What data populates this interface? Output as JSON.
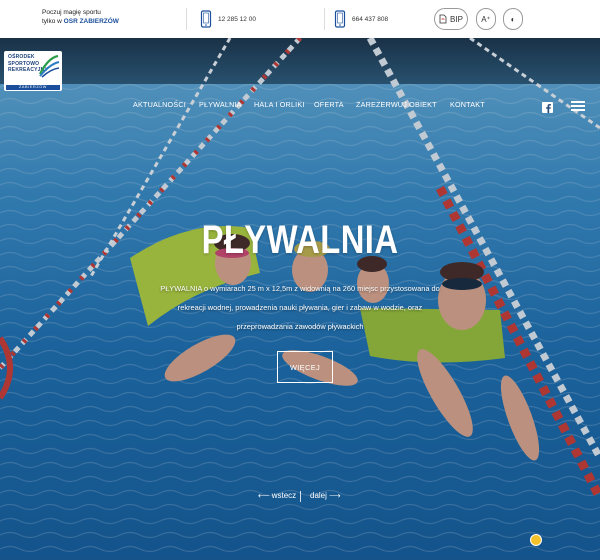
{
  "topbar": {
    "tagline_line1": "Poczuj magię sportu",
    "tagline_line2_prefix": "tylko w ",
    "tagline_brand": "OSR ZABIERZÓW",
    "phone1": "12 285 12 00",
    "phone2": "664 437 808",
    "bip_label": "BIP",
    "fontsize_label": "A⁺",
    "contrast_label": "◐"
  },
  "logo": {
    "line1": "OŚRODEK",
    "line2": "SPORTOWO",
    "line3": "REKREACYJNY",
    "bottom": "ZABIERZÓW"
  },
  "nav": {
    "items": [
      "AKTUALNOŚCI",
      "PŁYWALNIA",
      "HALA I ORLIKI",
      "OFERTA",
      "ZAREZERWUJ OBIEKT",
      "KONTAKT"
    ]
  },
  "hero": {
    "title": "PŁYWALNIA",
    "desc_line1": "PŁYWALNIA o wymiarach 25 m x 12,5m z widownią na 260 miejsc przystosowana do",
    "desc_line2": "rekreacji wodnej, prowadzenia nauki pływania, gier i zabaw w wodzie, oraz",
    "desc_line3": "przeprowadzania zawodów pływackich",
    "more_label": "WIĘCEJ"
  },
  "pager": {
    "prev_label": "⟵ wstecz",
    "next_label": "dalej ⟶"
  },
  "colors": {
    "brand_blue": "#1b4f9c",
    "water": "#1f6fae",
    "lane_red": "#c8322c",
    "float_green": "#b7d43a",
    "badge_yellow": "#f4c12b"
  },
  "icons": {
    "phone": "phone-icon",
    "facebook": "facebook-icon",
    "menu": "hamburger-menu-icon",
    "bip": "bip-icon",
    "font_size": "font-size-icon",
    "contrast": "contrast-icon"
  }
}
